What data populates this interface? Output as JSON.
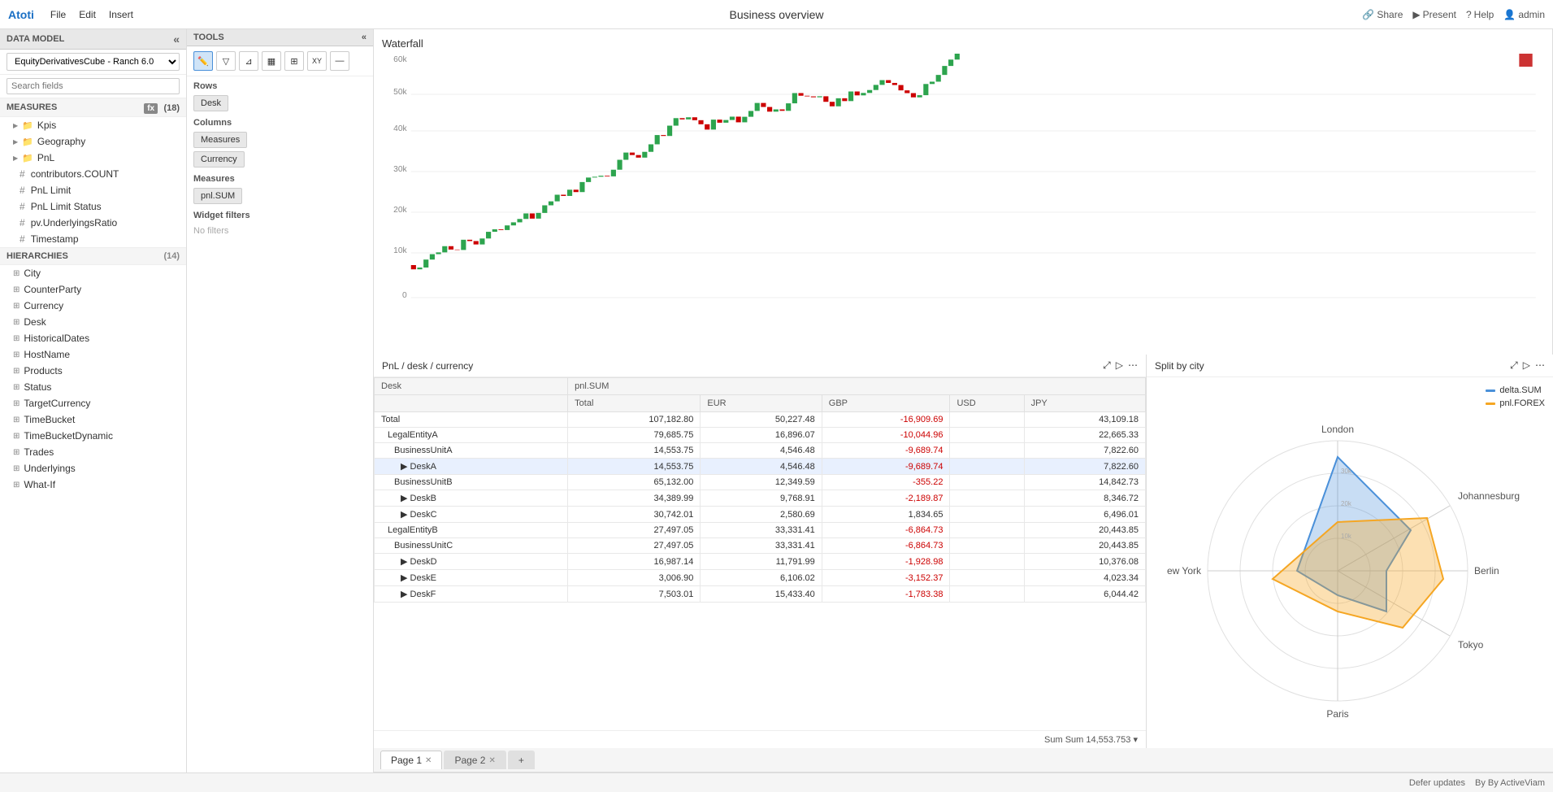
{
  "app": {
    "logo": "Atoti",
    "menu": [
      "File",
      "Edit",
      "Insert"
    ],
    "title": "Business overview",
    "actions": {
      "share": "Share",
      "present": "Present",
      "help": "Help",
      "user": "admin"
    }
  },
  "sidebar": {
    "header": "DATA MODEL",
    "cube": "EquityDerivativesCube - Ranch 6.0",
    "search_placeholder": "Search fields",
    "measures_label": "MEASURES",
    "measures_count": "(18)",
    "measures_items": [
      {
        "type": "folder",
        "label": "Kpis"
      },
      {
        "type": "folder",
        "label": "Geography"
      },
      {
        "type": "folder",
        "label": "PnL"
      },
      {
        "type": "hash",
        "label": "contributors.COUNT"
      },
      {
        "type": "hash",
        "label": "PnL Limit"
      },
      {
        "type": "hash",
        "label": "PnL Limit Status"
      },
      {
        "type": "hash",
        "label": "pv.UnderlyingsRatio"
      },
      {
        "type": "hash",
        "label": "Timestamp"
      }
    ],
    "hierarchies_label": "HIERARCHIES",
    "hierarchies_count": "(14)",
    "hierarchies_items": [
      "City",
      "CounterParty",
      "Currency",
      "Desk",
      "HistoricalDates",
      "HostName",
      "Products",
      "Status",
      "TargetCurrency",
      "TimeBucket",
      "TimeBucketDynamic",
      "Trades",
      "Underlyings",
      "What-If"
    ]
  },
  "tools": {
    "header": "TOOLS",
    "icons": [
      "pencil",
      "filter",
      "funnel",
      "bar-chart",
      "grid",
      "xy",
      "minus"
    ],
    "rows_label": "Rows",
    "rows_items": [
      "Desk"
    ],
    "columns_label": "Columns",
    "columns_items": [
      "Measures",
      "Currency"
    ],
    "measures_label": "Measures",
    "measures_items": [
      "pnl.SUM"
    ],
    "widget_filters_label": "Widget filters",
    "no_filters": "No filters"
  },
  "tabs": [
    {
      "label": "Page 1",
      "active": true,
      "closable": false
    },
    {
      "label": "Page 2",
      "active": false,
      "closable": true
    }
  ],
  "waterfall": {
    "title": "Waterfall"
  },
  "pivot": {
    "title": "PnL / desk / currency",
    "columns": [
      "Desk",
      "pnl.SUM",
      "",
      "",
      "",
      ""
    ],
    "sub_columns": [
      "",
      "Total",
      "EUR",
      "GBP",
      "USD",
      "JPY"
    ],
    "rows": [
      {
        "label": "Total",
        "indent": 0,
        "total": "107,182.80",
        "eur": "50,227.48",
        "gbp": "-16,909.69",
        "usd": "",
        "jpy": "43,109.18",
        "highlight": false
      },
      {
        "label": "LegalEntityA",
        "indent": 1,
        "total": "79,685.75",
        "eur": "16,896.07",
        "gbp": "-10,044.96",
        "usd": "",
        "jpy": "22,665.33",
        "highlight": false
      },
      {
        "label": "BusinessUnitA",
        "indent": 2,
        "total": "14,553.75",
        "eur": "4,546.48",
        "gbp": "-9,689.74",
        "usd": "",
        "jpy": "7,822.60",
        "highlight": false
      },
      {
        "label": "DeskA",
        "indent": 3,
        "total": "14,553.75",
        "eur": "4,546.48",
        "gbp": "-9,689.74",
        "usd": "",
        "jpy": "7,822.60",
        "highlight": true
      },
      {
        "label": "BusinessUnitB",
        "indent": 2,
        "total": "65,132.00",
        "eur": "12,349.59",
        "gbp": "-355.22",
        "usd": "",
        "jpy": "14,842.73",
        "highlight": false
      },
      {
        "label": "DeskB",
        "indent": 3,
        "total": "34,389.99",
        "eur": "9,768.91",
        "gbp": "-2,189.87",
        "usd": "",
        "jpy": "8,346.72",
        "highlight": false
      },
      {
        "label": "DeskC",
        "indent": 3,
        "total": "30,742.01",
        "eur": "2,580.69",
        "gbp": "1,834.65",
        "usd": "",
        "jpy": "6,496.01",
        "highlight": false
      },
      {
        "label": "LegalEntityB",
        "indent": 1,
        "total": "27,497.05",
        "eur": "33,331.41",
        "gbp": "-6,864.73",
        "usd": "",
        "jpy": "20,443.85",
        "highlight": false
      },
      {
        "label": "BusinessUnitC",
        "indent": 2,
        "total": "27,497.05",
        "eur": "33,331.41",
        "gbp": "-6,864.73",
        "usd": "",
        "jpy": "20,443.85",
        "highlight": false
      },
      {
        "label": "DeskD",
        "indent": 3,
        "total": "16,987.14",
        "eur": "11,791.99",
        "gbp": "-1,928.98",
        "usd": "",
        "jpy": "10,376.08",
        "highlight": false
      },
      {
        "label": "DeskE",
        "indent": 3,
        "total": "3,006.90",
        "eur": "6,106.02",
        "gbp": "-3,152.37",
        "usd": "",
        "jpy": "4,023.34",
        "highlight": false
      },
      {
        "label": "DeskF",
        "indent": 3,
        "total": "7,503.01",
        "eur": "15,433.40",
        "gbp": "-1,783.38",
        "usd": "",
        "jpy": "6,044.42",
        "highlight": false
      }
    ],
    "footer": "Sum 14,553.753"
  },
  "split_chart": {
    "title": "Split by city",
    "cities": [
      "London",
      "Johannesburg",
      "Berlin",
      "Tokyo",
      "Paris",
      "New York"
    ],
    "legend": [
      {
        "label": "delta.SUM",
        "color": "#4a90d9"
      },
      {
        "label": "pnl.FOREX",
        "color": "#f5a623"
      }
    ]
  },
  "status_bar": {
    "defer_updates": "Defer updates",
    "by": "By ActiveViam"
  },
  "colors": {
    "accent": "#1a6fc4",
    "negative": "#cc0000",
    "highlight_bg": "#e8f0fe",
    "chart_green": "#2da44e",
    "chart_red": "#cc0000",
    "radar_blue": "#4a90d9",
    "radar_orange": "#f5a623"
  }
}
